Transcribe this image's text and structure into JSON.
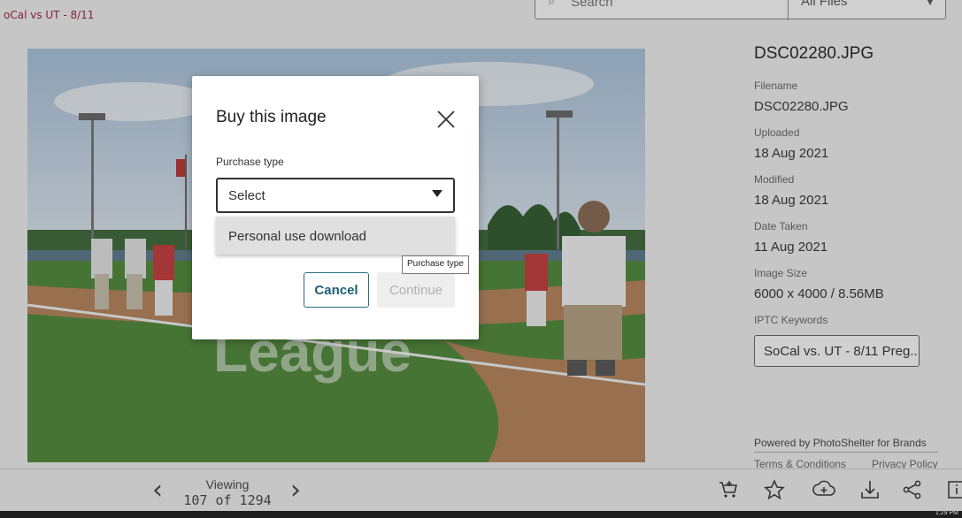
{
  "header": {
    "breadcrumb": "oCal vs UT - 8/11",
    "search_placeholder": "Search",
    "filter_value": "All Files"
  },
  "photo": {
    "overlay_text": "League"
  },
  "info": {
    "title": "DSC02280.JPG",
    "fields": [
      {
        "label": "Filename",
        "value": "DSC02280.JPG"
      },
      {
        "label": "Uploaded",
        "value": "18 Aug 2021"
      },
      {
        "label": "Modified",
        "value": "18 Aug 2021"
      },
      {
        "label": "Date Taken",
        "value": "11 Aug 2021"
      },
      {
        "label": "Image Size",
        "value": "6000 x 4000 / 8.56MB"
      }
    ],
    "keywords_label": "IPTC Keywords",
    "keywords_value": "SoCal vs. UT - 8/11 Preg...",
    "powered_by": "Powered by PhotoShelter for Brands",
    "terms": "Terms & Conditions",
    "privacy": "Privacy Policy"
  },
  "bottom": {
    "viewing_label": "Viewing",
    "viewing_count": "107 of 1294",
    "taskbar_time": "1:29 PM"
  },
  "modal": {
    "title": "Buy this image",
    "purchase_label": "Purchase type",
    "select_value": "Select",
    "option": "Personal use download",
    "cancel": "Cancel",
    "continue": "Continue",
    "tooltip": "Purchase type"
  },
  "colors": {
    "accent": "#1d5f78",
    "breadcrumb": "#a0213d"
  },
  "icons": [
    "search-icon",
    "chevron-down-icon",
    "chevron-left-icon",
    "chevron-right-icon",
    "cart-icon",
    "star-icon",
    "add-to-gallery-icon",
    "download-icon",
    "share-icon",
    "info-icon",
    "close-icon"
  ]
}
